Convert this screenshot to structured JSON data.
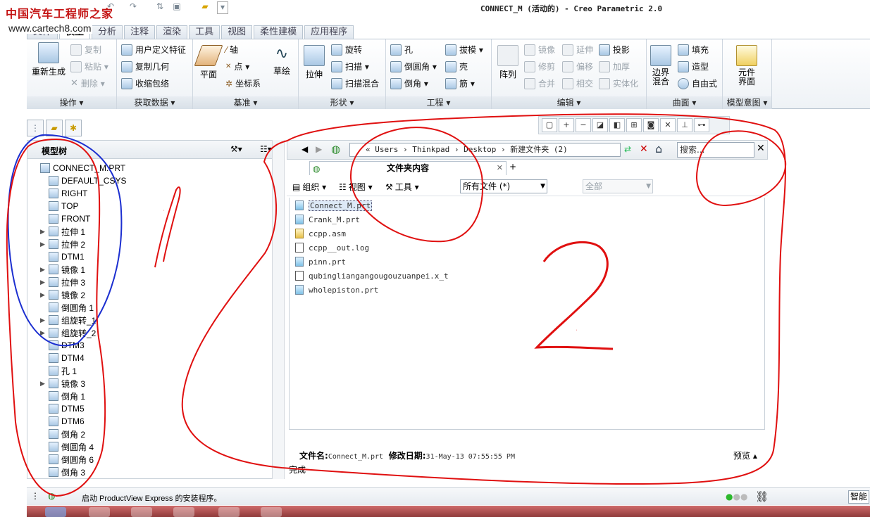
{
  "watermark": {
    "title": "中国汽车工程师之家",
    "url": "www.cartech8.com"
  },
  "window": {
    "title": "CONNECT_M (活动的) - Creo Parametric 2.0"
  },
  "ribbon": {
    "tabs": [
      "文件",
      "模型",
      "分析",
      "注释",
      "渲染",
      "工具",
      "视图",
      "柔性建模",
      "应用程序"
    ],
    "groups": {
      "operations": {
        "label": "操作 ▾",
        "regen": "重新生成",
        "copy": "复制",
        "paste": "粘贴 ▾",
        "delete": "删除 ▾"
      },
      "get_data": {
        "label": "获取数据 ▾",
        "udf": "用户定义特征",
        "copy_geom": "复制几何",
        "shrinkwrap": "收缩包络"
      },
      "datum": {
        "label": "基准 ▾",
        "plane": "平面",
        "axis": "轴",
        "point": "点 ▾",
        "csys": "坐标系",
        "sketch": "草绘"
      },
      "shapes": {
        "label": "形状 ▾",
        "extrude": "拉伸",
        "revolve": "旋转",
        "sweep": "扫描 ▾",
        "swept_blend": "扫描混合"
      },
      "engineering": {
        "label": "工程 ▾",
        "hole": "孔",
        "round": "倒圆角 ▾",
        "chamfer": "倒角 ▾",
        "draft": "拔模 ▾",
        "shell": "壳",
        "rib": "筋 ▾"
      },
      "editing": {
        "label": "编辑 ▾",
        "pattern": "阵列",
        "mirror": "镜像",
        "trim": "修剪",
        "merge": "合并",
        "extend": "延伸",
        "offset": "偏移",
        "intersect": "相交",
        "project": "投影",
        "thicken": "加厚",
        "solidify": "实体化"
      },
      "surfaces": {
        "label": "曲面 ▾",
        "boundary": "边界混合",
        "fill": "填充",
        "style": "造型",
        "freestyle": "自由式"
      },
      "model_intent": {
        "label": "模型意图 ▾",
        "component": "元件界面"
      }
    }
  },
  "model_tree": {
    "title": "模型树",
    "items": [
      {
        "label": "CONNECT_M.PRT",
        "exp": ""
      },
      {
        "label": "DEFAULT_CSYS",
        "exp": ""
      },
      {
        "label": "RIGHT",
        "exp": ""
      },
      {
        "label": "TOP",
        "exp": ""
      },
      {
        "label": "FRONT",
        "exp": ""
      },
      {
        "label": "拉伸 1",
        "exp": "▶"
      },
      {
        "label": "拉伸 2",
        "exp": "▶"
      },
      {
        "label": "DTM1",
        "exp": ""
      },
      {
        "label": "镜像 1",
        "exp": "▶"
      },
      {
        "label": "拉伸 3",
        "exp": "▶"
      },
      {
        "label": "镜像 2",
        "exp": "▶"
      },
      {
        "label": "倒圆角 1",
        "exp": ""
      },
      {
        "label": "组旋转_1",
        "exp": "▶"
      },
      {
        "label": "组旋转_2",
        "exp": "▶"
      },
      {
        "label": "DTM3",
        "exp": ""
      },
      {
        "label": "DTM4",
        "exp": ""
      },
      {
        "label": "孔 1",
        "exp": ""
      },
      {
        "label": "镜像 3",
        "exp": "▶"
      },
      {
        "label": "倒角 1",
        "exp": ""
      },
      {
        "label": "DTM5",
        "exp": ""
      },
      {
        "label": "DTM6",
        "exp": ""
      },
      {
        "label": "倒角 2",
        "exp": ""
      },
      {
        "label": "倒圆角 4",
        "exp": ""
      },
      {
        "label": "倒圆角 6",
        "exp": ""
      },
      {
        "label": "倒角 3",
        "exp": ""
      }
    ]
  },
  "browser": {
    "path": "« Users › Thinkpad › Desktop › 新建文件夹 (2)",
    "search_placeholder": "搜索...",
    "tab_label": "文件夹内容",
    "organize": "组织 ▾",
    "view": "视图 ▾",
    "tools": "工具 ▾",
    "filter_value": "所有文件 (*)",
    "filter2_value": "全部",
    "files": [
      {
        "name": "Connect_M.prt",
        "type": "prt"
      },
      {
        "name": "Crank_M.prt",
        "type": "prt"
      },
      {
        "name": "ccpp.asm",
        "type": "asm"
      },
      {
        "name": "ccpp__out.log",
        "type": "doc"
      },
      {
        "name": "pinn.prt",
        "type": "prt"
      },
      {
        "name": "qubingliangangougouzuanpei.x_t",
        "type": "doc"
      },
      {
        "name": "wholepiston.prt",
        "type": "prt"
      }
    ],
    "filename_label": "文件名:",
    "filename_value": "Connect_M.prt",
    "modified_label": "修改日期:",
    "modified_value": "31-May-13 07:55:55 PM",
    "preview": "预览 ▴",
    "done": "完成"
  },
  "statusbar": {
    "message": "启动 ProductView Express 的安装程序。",
    "smart": "智能"
  },
  "annotations": {
    "label1": "1",
    "label2": "2",
    "color": "#e01010",
    "tree_circle_color": "#1c2fd0"
  }
}
